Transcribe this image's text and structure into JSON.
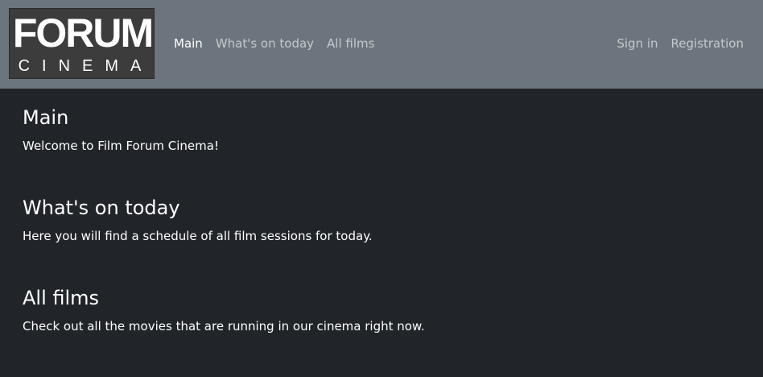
{
  "logo": {
    "line1": "FORUM",
    "line2": "CINEMA"
  },
  "nav": {
    "left": [
      {
        "label": "Main",
        "active": true
      },
      {
        "label": "What's on today",
        "active": false
      },
      {
        "label": "All films",
        "active": false
      }
    ],
    "right": [
      {
        "label": "Sign in"
      },
      {
        "label": "Registration"
      }
    ]
  },
  "sections": [
    {
      "title": "Main",
      "text": "Welcome to Film Forum Cinema!"
    },
    {
      "title": "What's on today",
      "text": "Here you will find a schedule of all film sessions for today."
    },
    {
      "title": "All films",
      "text": "Check out all the movies that are running in our cinema right now."
    }
  ],
  "colors": {
    "navbar": "#6c757d",
    "background": "#212529"
  }
}
